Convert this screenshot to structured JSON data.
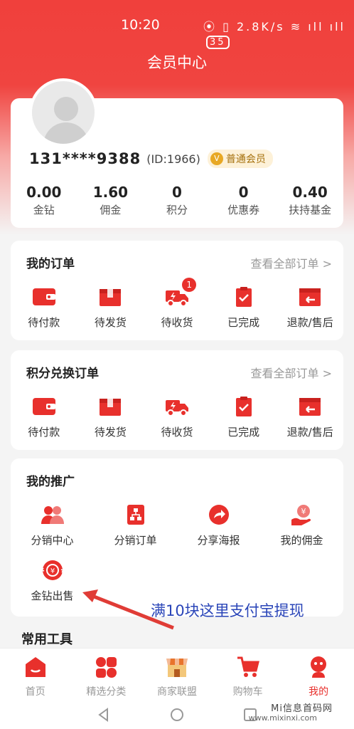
{
  "status": {
    "time": "10:20",
    "icons": "⦿ ▯ 2.8K/s ≋ ıll ıll",
    "battery": "35"
  },
  "header": {
    "title": "会员中心"
  },
  "profile": {
    "phone": "131****9388",
    "uid": "(ID:1966)",
    "level": "普通会员",
    "stats": [
      {
        "value": "0.00",
        "label": "金钻"
      },
      {
        "value": "1.60",
        "label": "佣金"
      },
      {
        "value": "0",
        "label": "积分"
      },
      {
        "value": "0",
        "label": "优惠券"
      },
      {
        "value": "0.40",
        "label": "扶持基金"
      }
    ]
  },
  "orders": {
    "title": "我的订单",
    "more": "查看全部订单 >",
    "items": [
      {
        "label": "待付款",
        "icon": "wallet-icon"
      },
      {
        "label": "待发货",
        "icon": "box-icon"
      },
      {
        "label": "待收货",
        "icon": "truck-icon",
        "badge": "1"
      },
      {
        "label": "已完成",
        "icon": "clipboard-check-icon"
      },
      {
        "label": "退款/售后",
        "icon": "refund-icon"
      }
    ]
  },
  "exchange": {
    "title": "积分兑换订单",
    "more": "查看全部订单 >",
    "items": [
      {
        "label": "待付款"
      },
      {
        "label": "待发货"
      },
      {
        "label": "待收货"
      },
      {
        "label": "已完成"
      },
      {
        "label": "退款/售后"
      }
    ]
  },
  "promo": {
    "title": "我的推广",
    "items": [
      {
        "label": "分销中心",
        "icon": "team-icon"
      },
      {
        "label": "分销订单",
        "icon": "org-icon"
      },
      {
        "label": "分享海报",
        "icon": "share-icon"
      },
      {
        "label": "我的佣金",
        "icon": "commission-icon"
      },
      {
        "label": "金钻出售",
        "icon": "yen-sell-icon"
      }
    ]
  },
  "annotation": "满10块这里支付宝提现",
  "tools": {
    "title": "常用工具"
  },
  "tabs": [
    {
      "label": "首页",
      "icon": "home-icon"
    },
    {
      "label": "精选分类",
      "icon": "category-icon"
    },
    {
      "label": "商家联盟",
      "icon": "store-icon"
    },
    {
      "label": "购物车",
      "icon": "cart-icon"
    },
    {
      "label": "我的",
      "icon": "profile-icon"
    }
  ],
  "watermark": {
    "main": "Mi信息首码网",
    "sub": "www.mixinxi.com"
  },
  "colors": {
    "brand": "#e8302c",
    "annotation": "#2a45b8"
  }
}
